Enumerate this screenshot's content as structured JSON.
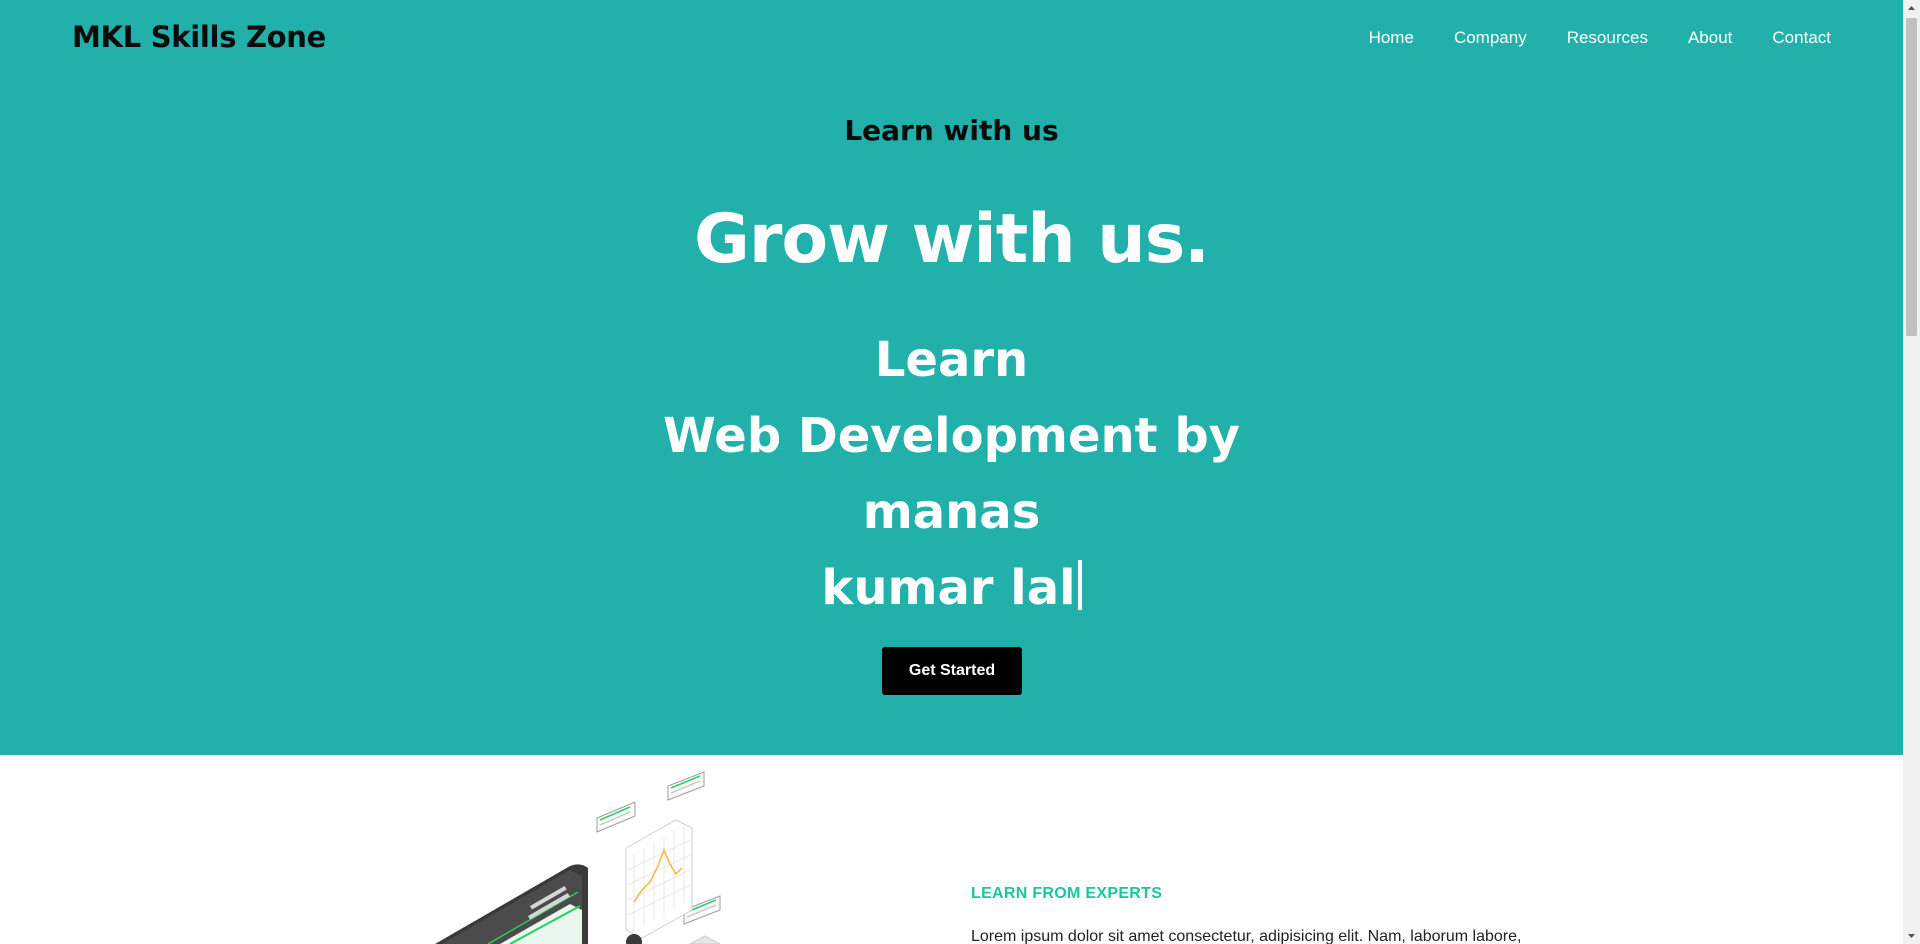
{
  "colors": {
    "hero_bg": "#21b0aa",
    "accent_green": "#18c79a",
    "button_bg": "#000000"
  },
  "header": {
    "brand": "MKL Skills Zone",
    "nav": [
      "Home",
      "Company",
      "Resources",
      "About",
      "Contact"
    ]
  },
  "hero": {
    "tagline": "Learn with us",
    "title": "Grow with us.",
    "typed_lines": [
      "Learn",
      "Web Development by manas",
      "kumar lal"
    ],
    "cta_label": "Get Started"
  },
  "section": {
    "eyebrow": "LEARN FROM EXPERTS",
    "body": "Lorem ipsum dolor sit amet consectetur, adipisicing elit. Nam, laborum labore,"
  },
  "icons": {
    "illustration": "analytics-dashboard-illustration",
    "scroll_up": "chevron-up-icon",
    "scroll_down": "chevron-down-icon"
  }
}
